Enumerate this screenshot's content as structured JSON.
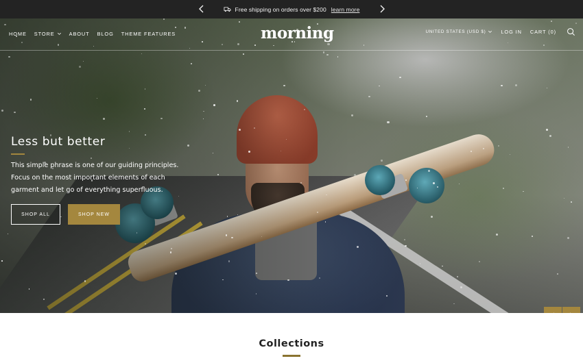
{
  "announcement": {
    "text": "Free shipping on orders over $200",
    "link": "learn more",
    "prev_icon": "chevron-left-icon",
    "next_icon": "chevron-right-icon",
    "shipping_icon": "truck-icon"
  },
  "header": {
    "logo": "morning",
    "nav": [
      {
        "label": "HOME"
      },
      {
        "label": "STORE",
        "has_dropdown": true
      },
      {
        "label": "ABOUT"
      },
      {
        "label": "BLOG"
      },
      {
        "label": "THEME FEATURES"
      }
    ],
    "country": "UNITED STATES (USD $)",
    "login": "LOG IN",
    "cart": "CART (0)",
    "search_icon": "search-icon"
  },
  "hero": {
    "title": "Less but better",
    "text": "This simple phrase is one of our guiding principles. Focus on the most important elements of each garment and let go of everything superfluous.",
    "buttons": {
      "shop_all": "SHOP ALL",
      "shop_new": "SHOP NEW"
    },
    "slides_total": 4,
    "active_slide": 1
  },
  "collections": {
    "title": "Collections"
  },
  "colors": {
    "accent": "#a4873e",
    "topbar": "#232323"
  }
}
